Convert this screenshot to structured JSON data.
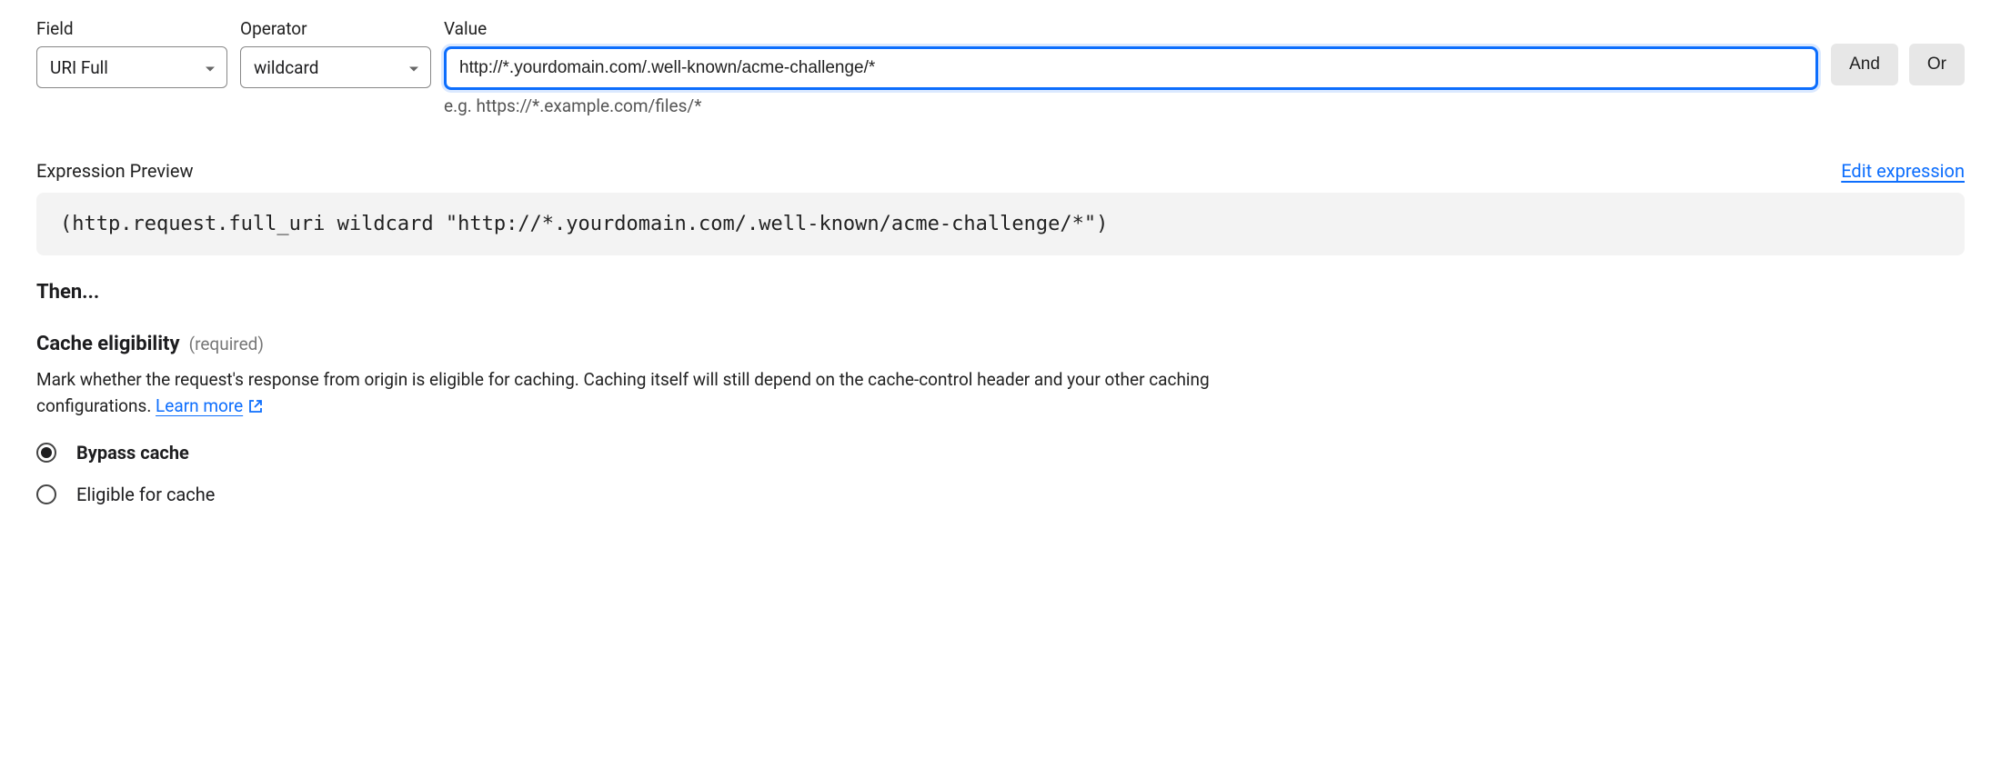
{
  "filter": {
    "field": {
      "label": "Field",
      "value": "URI Full"
    },
    "operator": {
      "label": "Operator",
      "value": "wildcard"
    },
    "value": {
      "label": "Value",
      "input": "http://*.yourdomain.com/.well-known/acme-challenge/*",
      "hint": "e.g. https://*.example.com/files/*"
    },
    "buttons": {
      "and": "And",
      "or": "Or"
    }
  },
  "preview": {
    "label": "Expression Preview",
    "edit": "Edit expression",
    "code": "(http.request.full_uri wildcard \"http://*.yourdomain.com/.well-known/acme-challenge/*\")"
  },
  "then": "Then...",
  "cache": {
    "title": "Cache eligibility",
    "required": "(required)",
    "description": "Mark whether the request's response from origin is eligible for caching. Caching itself will still depend on the cache-control header and your other caching configurations. ",
    "learn_more": "Learn more",
    "options": [
      {
        "label": "Bypass cache",
        "selected": true
      },
      {
        "label": "Eligible for cache",
        "selected": false
      }
    ]
  }
}
